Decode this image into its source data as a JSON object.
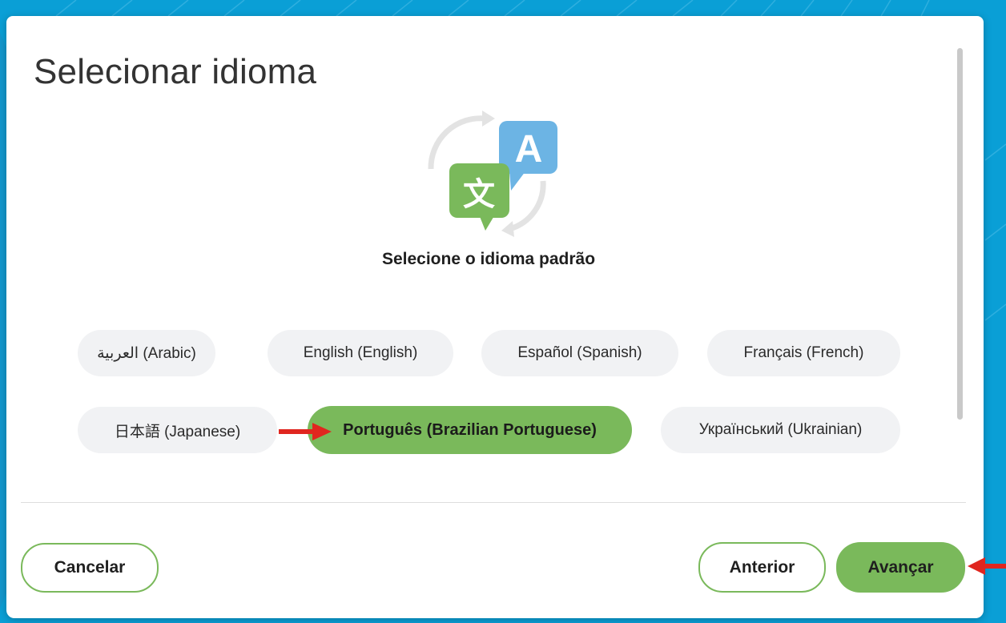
{
  "dialog": {
    "title": "Selecionar idioma",
    "subtitle": "Selecione o idioma padrão",
    "icon": "language-translate-icon"
  },
  "languages": [
    {
      "label": "العربية (Arabic)",
      "selected": false
    },
    {
      "label": "English (English)",
      "selected": false
    },
    {
      "label": "Español (Spanish)",
      "selected": false
    },
    {
      "label": "Français (French)",
      "selected": false
    },
    {
      "label": "日本語 (Japanese)",
      "selected": false
    },
    {
      "label": "Português (Brazilian Portuguese)",
      "selected": true
    },
    {
      "label": "Український (Ukrainian)",
      "selected": false
    }
  ],
  "footer": {
    "cancel_label": "Cancelar",
    "previous_label": "Anterior",
    "next_label": "Avançar"
  },
  "colors": {
    "accent": "#7ab95b",
    "background": "#0a9fd6",
    "annotation_arrow": "#e0261f"
  }
}
